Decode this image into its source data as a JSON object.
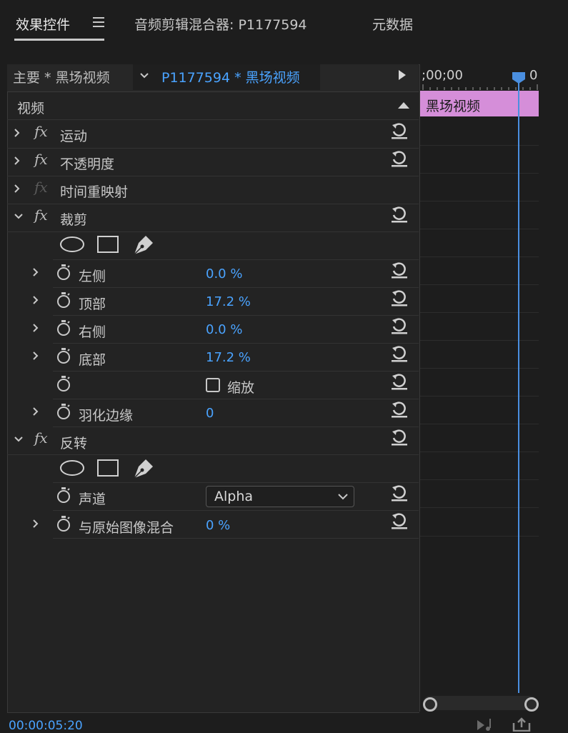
{
  "tabs": [
    {
      "label": "效果控件"
    },
    {
      "label": "音频剪辑混合器: P1177594"
    },
    {
      "label": "元数据"
    }
  ],
  "header": {
    "master": "主要 * 黑场视频",
    "clip": "P1177594 * 黑场视频"
  },
  "timeline": {
    "timecode_left": ";00;00",
    "timecode_right": "0",
    "clip_label": "黑场视频"
  },
  "section": {
    "video": "视频"
  },
  "effects": {
    "motion": "运动",
    "opacity": "不透明度",
    "time_remap": "时间重映射",
    "crop": "裁剪",
    "invert": "反转"
  },
  "crop_params": [
    {
      "label": "左侧",
      "value": "0.0 %"
    },
    {
      "label": "顶部",
      "value": "17.2 %"
    },
    {
      "label": "右侧",
      "value": "0.0 %"
    },
    {
      "label": "底部",
      "value": "17.2 %"
    }
  ],
  "crop_zoom": {
    "label": "缩放"
  },
  "crop_feather": {
    "label": "羽化边缘",
    "value": "0"
  },
  "invert_params": {
    "channel_label": "声道",
    "channel_value": "Alpha",
    "blend_label": "与原始图像混合",
    "blend_value": "0 %"
  },
  "bottom": {
    "timecode": "00:00:05:20"
  },
  "icons": {
    "menu": "menu-icon",
    "reset": "reset-icon",
    "stopwatch": "stopwatch-icon",
    "ellipse": "ellipse-mask-icon",
    "rectangle": "rectangle-mask-icon",
    "pen": "pen-mask-icon"
  },
  "colors": {
    "accent": "#4aa3ff",
    "clip": "#d58ed9",
    "playhead": "#4a8fe0"
  }
}
